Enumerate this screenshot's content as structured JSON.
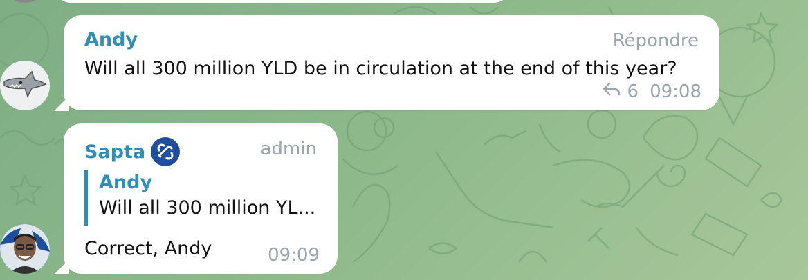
{
  "colors": {
    "accent": "#2f8fb8",
    "meta": "#9aa5ad",
    "bubble": "#ffffff",
    "wallpaper": "#8cb88a",
    "verified_badge": "#1e4f9c"
  },
  "messages": [
    {
      "sender": "Andy",
      "action_label": "Répondre",
      "text": "Will all 300 million YLD be in circulation at the end of this year?",
      "replies_count": "6",
      "time": "09:08",
      "avatar_icon": "shark-avatar-icon"
    },
    {
      "sender": "Sapta",
      "role_label": "admin",
      "badge_icon": "verified-link-icon",
      "quote": {
        "sender": "Andy",
        "text": "Will all 300 million YL..."
      },
      "text": "Correct, Andy",
      "time": "09:09",
      "avatar_icon": "user-photo-avatar"
    }
  ]
}
